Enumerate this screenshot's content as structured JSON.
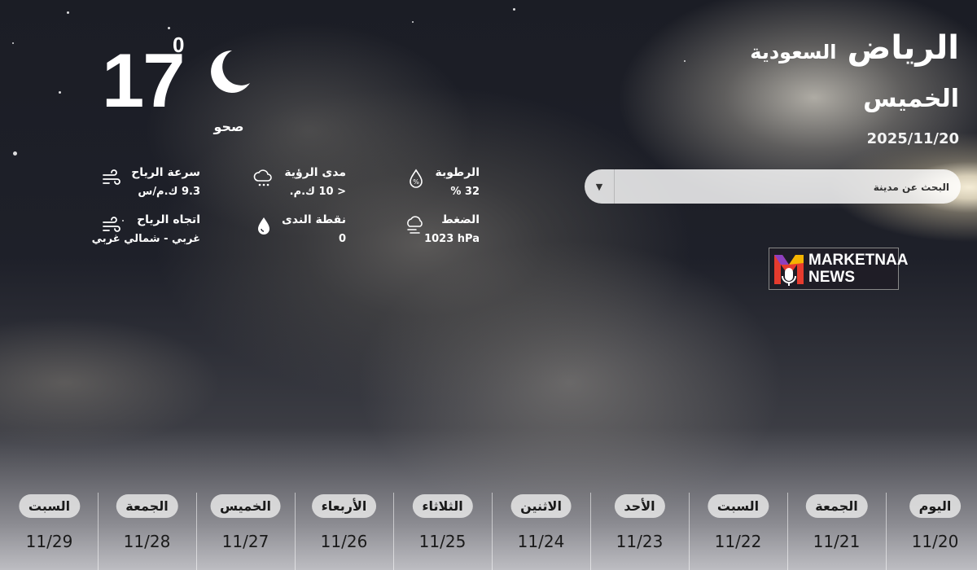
{
  "current": {
    "temperature": "17",
    "degree_symbol": "0",
    "condition": "صحو",
    "icon": "moon-icon"
  },
  "details": [
    {
      "id": "wind-speed",
      "label": "سرعة الرياح",
      "value": "9.3 ك.م/س",
      "icon": "wind-icon"
    },
    {
      "id": "visibility",
      "label": "مدى الرؤية",
      "value": "< 10 ك.م.",
      "icon": "rain-cloud-icon"
    },
    {
      "id": "humidity",
      "label": "الرطوبة",
      "value": "32 %",
      "icon": "humidity-drop-icon"
    },
    {
      "id": "wind-direction",
      "label": "اتجاه الرياح",
      "value": "غربي - شمالي غربي",
      "icon": "wind-icon"
    },
    {
      "id": "dew-point",
      "label": "نقطة الندى",
      "value": "0",
      "icon": "dew-drop-icon"
    },
    {
      "id": "pressure",
      "label": "الضغط",
      "value": "1023 hPa",
      "icon": "pressure-icon"
    }
  ],
  "location": {
    "city": "الرياض",
    "country": "السعودية",
    "day": "الخميس",
    "date": "2025/11/20"
  },
  "search": {
    "placeholder": "البحث عن مدينة"
  },
  "brand": {
    "line1": "MARKETNAA",
    "line2": "NEWS"
  },
  "forecast": [
    {
      "day": "اليوم",
      "date": "11/20"
    },
    {
      "day": "الجمعة",
      "date": "11/21"
    },
    {
      "day": "السبت",
      "date": "11/22"
    },
    {
      "day": "الأحد",
      "date": "11/23"
    },
    {
      "day": "الاثنين",
      "date": "11/24"
    },
    {
      "day": "الثلاثاء",
      "date": "11/25"
    },
    {
      "day": "الأربعاء",
      "date": "11/26"
    },
    {
      "day": "الخميس",
      "date": "11/27"
    },
    {
      "day": "الجمعة",
      "date": "11/28"
    },
    {
      "day": "السبت",
      "date": "11/29"
    }
  ]
}
